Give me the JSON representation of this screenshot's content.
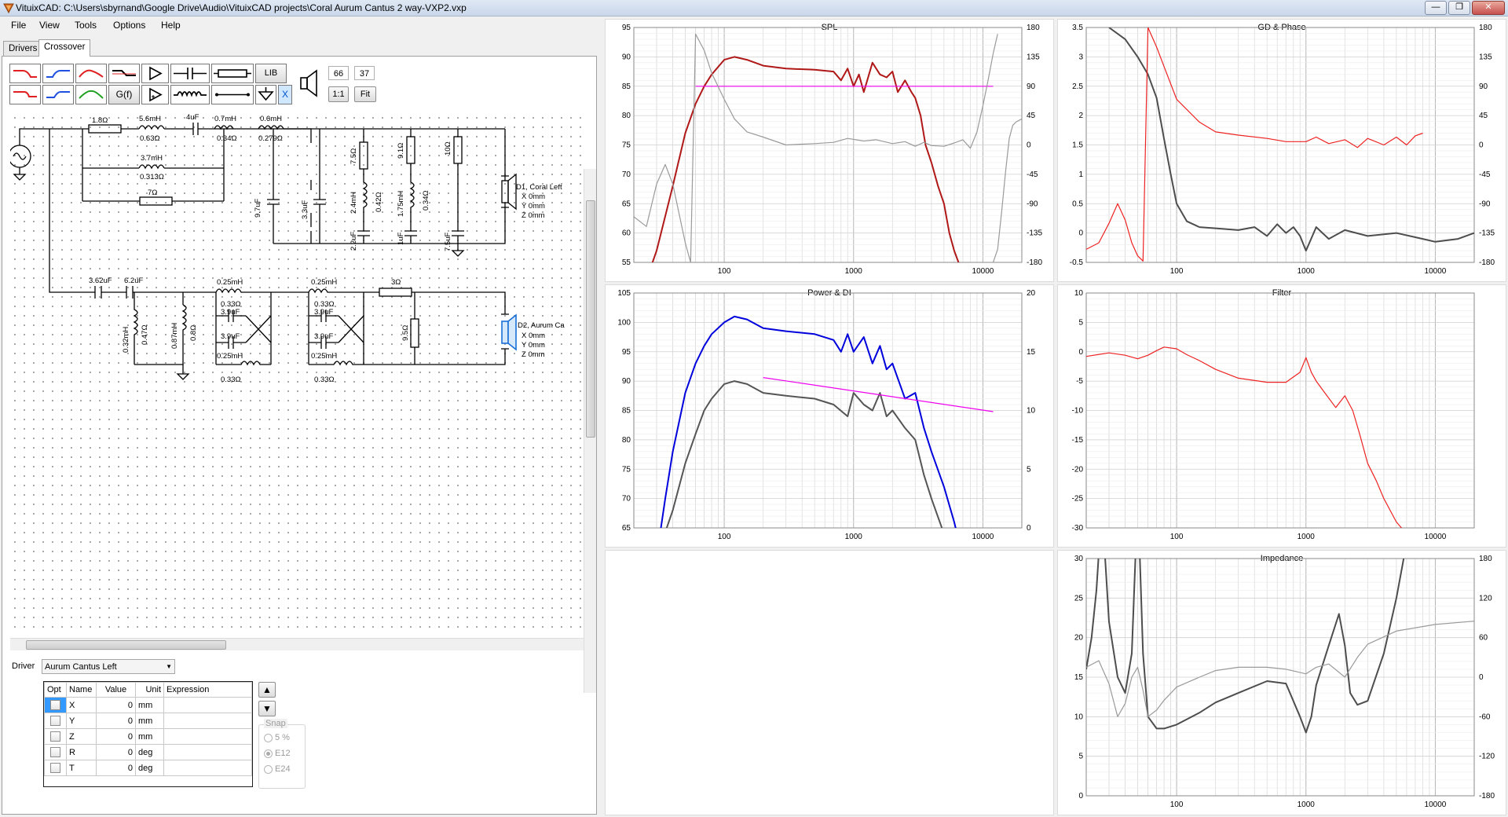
{
  "window": {
    "title": "VituixCAD: C:\\Users\\sbyrnand\\Google Drive\\Audio\\VituixCAD projects\\Coral Aurum Cantus 2 way-VXP2.vxp",
    "minimize": "—",
    "maximize": "❐",
    "close": "✕"
  },
  "menu": [
    "File",
    "View",
    "Tools",
    "Options",
    "Help"
  ],
  "tabs": [
    "Drivers",
    "Crossover"
  ],
  "toolbar": {
    "lib_label": "LIB",
    "gf_label": "G(f)",
    "x_label": "X",
    "zoom_value_1": "66",
    "zoom_value_2": "37",
    "one_to_one": "1:1",
    "fit": "Fit"
  },
  "schematic": {
    "labels": [
      "1.8Ω",
      "5.6mH",
      "0.63Ω",
      "4uF",
      "0.7mH",
      "0.34Ω",
      "0.6mH",
      "0.279Ω",
      "3.7mH",
      "0.313Ω",
      "7Ω",
      "9.7uF",
      "3.3uF",
      "7.5Ω",
      "2.4mH",
      "0.42Ω",
      "2.2uF",
      "9.1Ω",
      "1.75mH",
      "0.34Ω",
      "1uF",
      "10Ω",
      "7.5uF",
      "3.62uF",
      "6.2uF",
      "0.32mH",
      "0.47Ω",
      "0.87mH",
      "0.8Ω",
      "0.25mH",
      "0.33Ω",
      "3.9uF",
      "0.25mH",
      "0.33Ω",
      "3.9uF",
      "3.9uF",
      "3.9uF",
      "0.25mH",
      "0.33Ω",
      "0.25mH",
      "0.33Ω",
      "3Ω",
      "9.5Ω"
    ],
    "driver1": [
      "D1, Coral Left",
      "X 0mm",
      "Y 0mm",
      "Z 0mm"
    ],
    "driver2": [
      "D2, Aurum Ca",
      "X 0mm",
      "Y 0mm",
      "Z 0mm"
    ]
  },
  "driver_selector": {
    "label": "Driver",
    "value": "Aurum Cantus Left"
  },
  "param_table": {
    "headers": [
      "Opt",
      "Name",
      "Value",
      "Unit",
      "Expression"
    ],
    "rows": [
      {
        "name": "X",
        "value": "0",
        "unit": "mm"
      },
      {
        "name": "Y",
        "value": "0",
        "unit": "mm"
      },
      {
        "name": "Z",
        "value": "0",
        "unit": "mm"
      },
      {
        "name": "R",
        "value": "0",
        "unit": "deg"
      },
      {
        "name": "T",
        "value": "0",
        "unit": "deg"
      }
    ]
  },
  "snap": {
    "title": "Snap",
    "options": [
      "5 %",
      "E12",
      "E24"
    ],
    "selected": "E12"
  },
  "charts": {
    "spl": {
      "title": "SPL"
    },
    "gd": {
      "title": "GD & Phase"
    },
    "power": {
      "title": "Power & DI"
    },
    "filter": {
      "title": "Filter"
    },
    "impedance": {
      "title": "Impedance"
    }
  },
  "chart_data": [
    {
      "type": "line",
      "title": "SPL",
      "xscale": "log",
      "xlim": [
        20,
        20000
      ],
      "xticklabels": [
        "100",
        "1000",
        "10000"
      ],
      "ylim": [
        55,
        95
      ],
      "yticks": [
        55,
        60,
        65,
        70,
        75,
        80,
        85,
        90,
        95
      ],
      "y2lim": [
        -180,
        180
      ],
      "y2ticks": [
        -180,
        -135,
        -90,
        -45,
        0,
        45,
        90,
        135,
        180
      ],
      "series": [
        {
          "color": "#b01818",
          "x": [
            25,
            30,
            40,
            50,
            60,
            70,
            80,
            100,
            120,
            150,
            200,
            300,
            500,
            700,
            800,
            900,
            1000,
            1100,
            1200,
            1400,
            1600,
            1800,
            2000,
            2200,
            2500,
            2800,
            3000,
            3300,
            3600,
            4000,
            4500,
            5000,
            5500,
            6000,
            7000
          ],
          "y": [
            52,
            57,
            68,
            77,
            82,
            85,
            87,
            89.5,
            90,
            89.5,
            88.5,
            88,
            87.8,
            87.5,
            86,
            88,
            85,
            87,
            84,
            89,
            87,
            86.5,
            87.5,
            84,
            86,
            84,
            83,
            80,
            75,
            72,
            68,
            65,
            60,
            57,
            53
          ]
        },
        {
          "color": "#ee00ee",
          "x": [
            60,
            12000
          ],
          "y": [
            85,
            85
          ]
        },
        {
          "color": "#9a9a9a",
          "axis": "right",
          "x": [
            20,
            25,
            30,
            35,
            40,
            50,
            55,
            60,
            70,
            80,
            100,
            120,
            150,
            200,
            300,
            500,
            700,
            900,
            1200,
            1500,
            2000,
            2500,
            3000,
            3500,
            4000,
            5000,
            6000,
            7000,
            8000,
            9000,
            10000,
            11000,
            12000,
            13000
          ],
          "y": [
            -110,
            -125,
            -60,
            -30,
            -60,
            -150,
            -180,
            170,
            145,
            110,
            70,
            40,
            20,
            12,
            0,
            2,
            4,
            10,
            6,
            8,
            2,
            5,
            -2,
            4,
            -1,
            -2,
            3,
            8,
            -5,
            20,
            60,
            100,
            140,
            170
          ]
        },
        {
          "color": "#9a9a9a",
          "axis": "right",
          "x": [
            12000,
            13000,
            14000,
            15000,
            16000,
            17000,
            18000,
            20000
          ],
          "y": [
            -180,
            -160,
            -100,
            -40,
            10,
            30,
            35,
            40
          ]
        }
      ]
    },
    {
      "type": "line",
      "title": "GD & Phase",
      "xscale": "log",
      "xlim": [
        20,
        20000
      ],
      "xticklabels": [
        "100",
        "1000",
        "10000"
      ],
      "ylim": [
        -0.5,
        3.5
      ],
      "yticks": [
        -0.5,
        0,
        0.5,
        1,
        1.5,
        2,
        2.5,
        3,
        3.5
      ],
      "y2lim": [
        -180,
        180
      ],
      "y2ticks": [
        -180,
        -135,
        -90,
        -45,
        0,
        45,
        90,
        135,
        180
      ],
      "series": [
        {
          "color": "#4d4d4d",
          "x": [
            30,
            40,
            50,
            60,
            70,
            80,
            90,
            100,
            120,
            150,
            200,
            300,
            400,
            500,
            600,
            700,
            800,
            900,
            1000,
            1200,
            1500,
            2000,
            3000,
            5000,
            8000,
            10000,
            15000,
            20000
          ],
          "y": [
            3.5,
            3.3,
            3.0,
            2.7,
            2.3,
            1.6,
            1.0,
            0.5,
            0.2,
            0.1,
            0.08,
            0.05,
            0.1,
            -0.05,
            0.15,
            0,
            0.1,
            -0.05,
            -0.3,
            0.1,
            -0.1,
            0.05,
            -0.05,
            0,
            -0.1,
            -0.15,
            -0.1,
            0
          ]
        },
        {
          "color": "#ee2222",
          "axis": "right",
          "x": [
            20,
            25,
            30,
            35,
            40,
            45,
            50,
            55,
            60,
            70,
            80,
            100,
            150,
            200,
            300,
            500,
            700,
            1000,
            1200,
            1500,
            2000,
            2500,
            3000,
            4000,
            5000,
            6000,
            7000,
            8000
          ],
          "y": [
            -160,
            -150,
            -120,
            -90,
            -115,
            -150,
            -170,
            -178,
            180,
            150,
            120,
            70,
            35,
            20,
            15,
            10,
            5,
            5,
            12,
            2,
            8,
            -4,
            10,
            0,
            12,
            0,
            14,
            18
          ]
        }
      ]
    },
    {
      "type": "line",
      "title": "Power & DI",
      "xscale": "log",
      "xlim": [
        20,
        20000
      ],
      "xticklabels": [
        "100",
        "1000",
        "10000"
      ],
      "ylim": [
        65,
        105
      ],
      "yticks": [
        65,
        70,
        75,
        80,
        85,
        90,
        95,
        100,
        105
      ],
      "y2lim": [
        0,
        20
      ],
      "y2ticks": [
        0,
        5,
        10,
        15,
        20
      ],
      "series": [
        {
          "color": "#0000dd",
          "x": [
            30,
            35,
            40,
            50,
            60,
            70,
            80,
            100,
            120,
            150,
            200,
            300,
            500,
            700,
            800,
            900,
            1000,
            1200,
            1400,
            1600,
            1800,
            2000,
            2500,
            3000,
            3500,
            4000,
            5000,
            6000,
            7000
          ],
          "y": [
            60,
            70,
            78,
            88,
            93,
            96,
            98,
            100,
            101,
            100.5,
            99,
            98.5,
            98,
            97,
            95,
            98,
            95,
            97.5,
            93,
            96,
            92,
            93,
            87,
            88,
            82,
            78,
            72,
            66,
            60
          ]
        },
        {
          "color": "#555555",
          "x": [
            30,
            40,
            50,
            60,
            70,
            80,
            100,
            120,
            150,
            200,
            300,
            500,
            700,
            900,
            1000,
            1200,
            1400,
            1600,
            1800,
            2000,
            2500,
            3000,
            3500,
            4000,
            5000
          ],
          "y": [
            60,
            68,
            76,
            81,
            85,
            87,
            89.5,
            90,
            89.5,
            88,
            87.5,
            87,
            86,
            84,
            88,
            86,
            85,
            88,
            84,
            85,
            82,
            80,
            74,
            70,
            64
          ]
        },
        {
          "color": "#ee00ee",
          "axis": "right",
          "x": [
            200,
            12000
          ],
          "y": [
            12.8,
            9.9
          ]
        }
      ]
    },
    {
      "type": "line",
      "title": "Filter",
      "xscale": "log",
      "xlim": [
        20,
        20000
      ],
      "xticklabels": [
        "100",
        "1000",
        "10000"
      ],
      "ylim": [
        -30,
        10
      ],
      "yticks": [
        -30,
        -25,
        -20,
        -15,
        -10,
        -5,
        0,
        5,
        10
      ],
      "series": [
        {
          "color": "#ee2222",
          "x": [
            20,
            30,
            40,
            50,
            60,
            70,
            80,
            100,
            120,
            150,
            200,
            300,
            500,
            700,
            900,
            1000,
            1100,
            1200,
            1400,
            1700,
            2000,
            2300,
            2600,
            3000,
            3500,
            4000,
            5000,
            6000
          ],
          "y": [
            -0.8,
            -0.2,
            -0.6,
            -1.2,
            -0.6,
            0.2,
            0.8,
            0.5,
            -0.5,
            -1.5,
            -3,
            -4.5,
            -5.2,
            -5.2,
            -3.5,
            -1,
            -3.5,
            -5,
            -7,
            -9.5,
            -7.5,
            -10,
            -14,
            -19,
            -22,
            -25,
            -29,
            -31
          ]
        }
      ]
    },
    {
      "type": "line",
      "title": "Impedance",
      "xscale": "log",
      "xlim": [
        20,
        20000
      ],
      "xticklabels": [
        "100",
        "1000",
        "10000"
      ],
      "ylim": [
        0,
        30
      ],
      "yticks": [
        0,
        5,
        10,
        15,
        20,
        25,
        30
      ],
      "y2lim": [
        -180,
        180
      ],
      "y2ticks": [
        -180,
        -120,
        -60,
        0,
        60,
        120,
        180
      ],
      "series": [
        {
          "color": "#4d4d4d",
          "x": [
            20,
            22,
            24,
            26,
            28,
            30,
            35,
            40,
            45,
            48,
            50,
            52,
            55,
            60,
            70,
            80,
            100,
            150,
            200,
            300,
            500,
            700,
            900,
            1000,
            1100,
            1200,
            1500,
            1800,
            2000,
            2200,
            2500,
            3000,
            4000,
            5000,
            6000
          ],
          "y": [
            16,
            20,
            26,
            35,
            30,
            22,
            15,
            13,
            18,
            30,
            35,
            30,
            18,
            10,
            8.5,
            8.5,
            9,
            10.5,
            11.8,
            13,
            14.5,
            14.2,
            10,
            8,
            10,
            14,
            19,
            23,
            19,
            13,
            11.5,
            12,
            18,
            25,
            32
          ]
        },
        {
          "color": "#9a9a9a",
          "axis": "right",
          "x": [
            20,
            25,
            30,
            35,
            40,
            45,
            50,
            55,
            60,
            70,
            80,
            100,
            150,
            200,
            300,
            500,
            700,
            1000,
            1200,
            1500,
            2000,
            2500,
            3000,
            5000,
            10000,
            20000
          ],
          "y": [
            15,
            25,
            -10,
            -60,
            -40,
            0,
            15,
            -20,
            -60,
            -50,
            -35,
            -15,
            0,
            10,
            15,
            15,
            12,
            5,
            15,
            20,
            0,
            30,
            50,
            70,
            80,
            85
          ]
        }
      ]
    }
  ]
}
